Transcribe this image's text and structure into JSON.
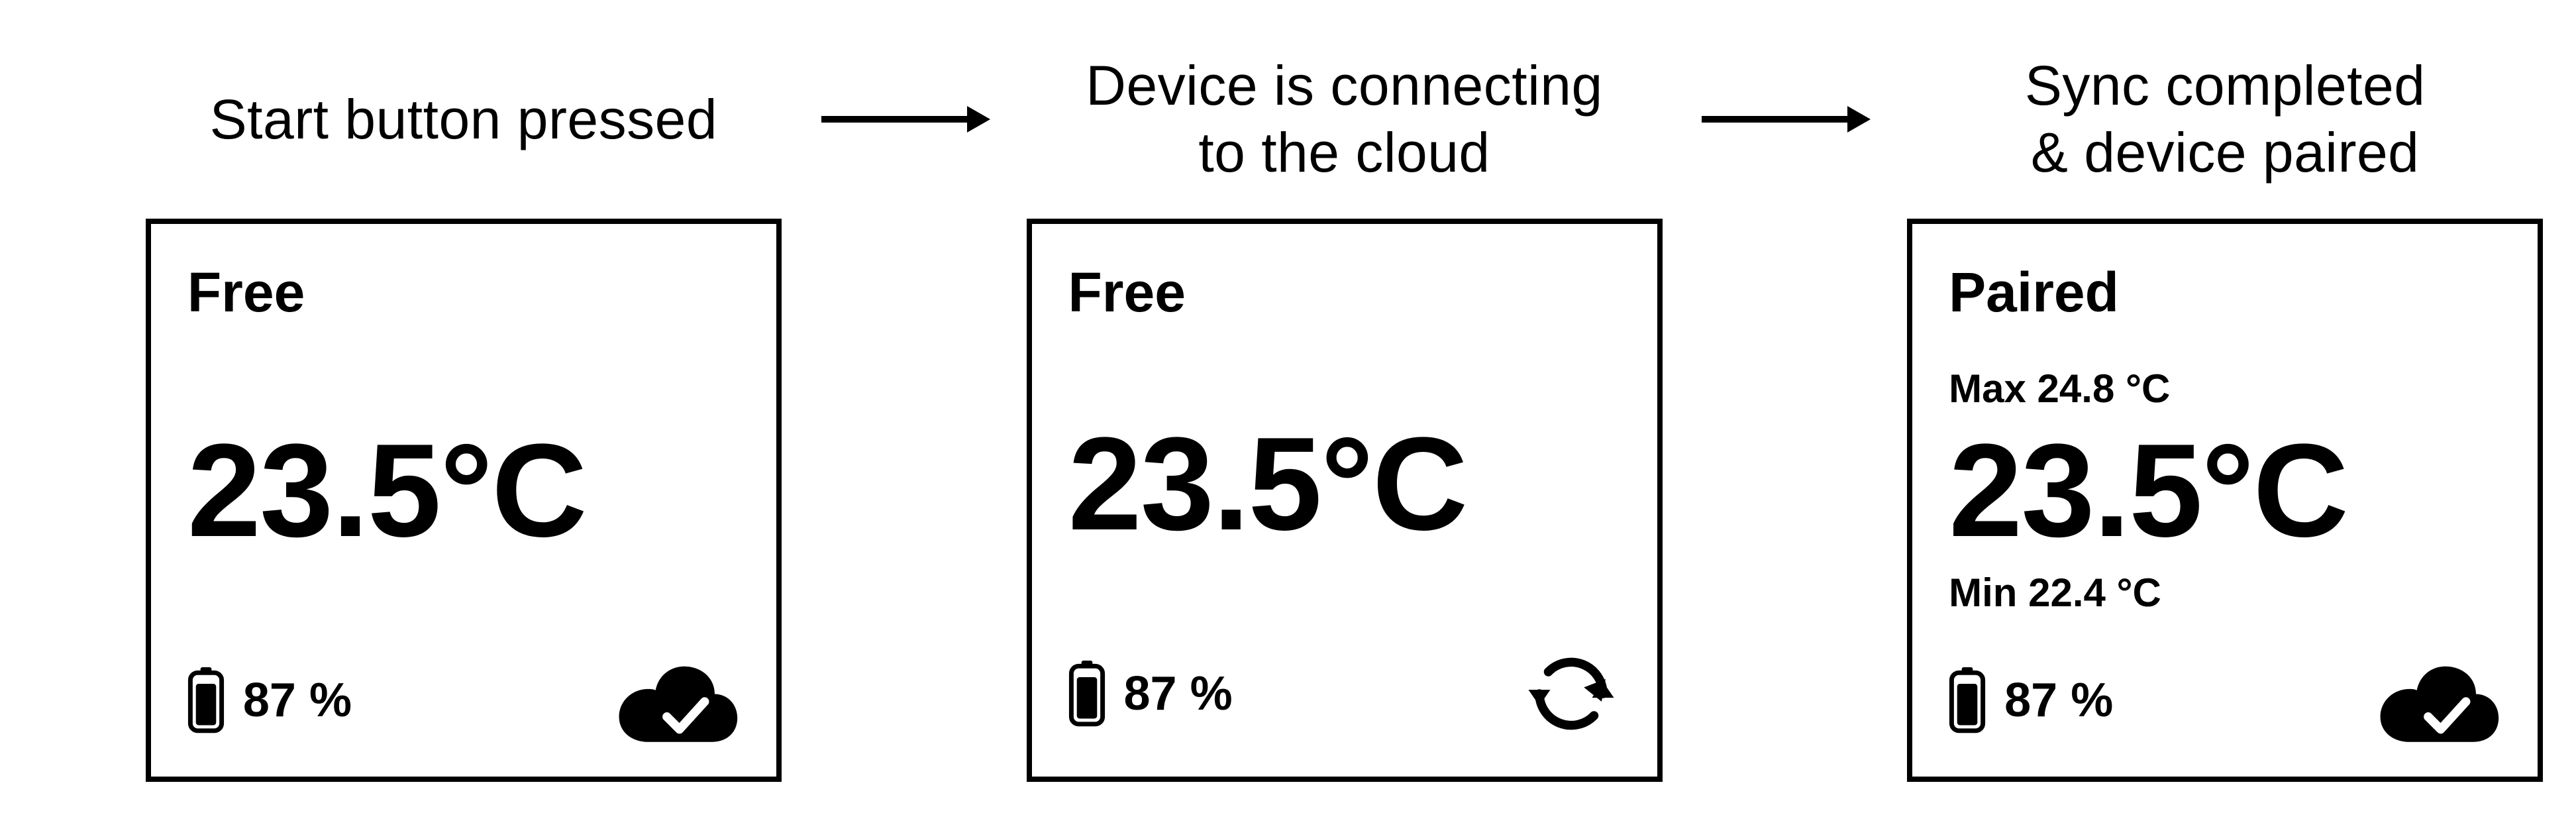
{
  "captions": {
    "step1": "Start button pressed",
    "step2": "Device is connecting\nto the cloud",
    "step3": "Sync completed\n& device paired"
  },
  "screens": [
    {
      "status": "Free",
      "temperature": "23.5°C",
      "battery": "87 %",
      "footer_icon": "cloud-check"
    },
    {
      "status": "Free",
      "temperature": "23.5°C",
      "battery": "87 %",
      "footer_icon": "sync"
    },
    {
      "status": "Paired",
      "max": "Max 24.8 °C",
      "temperature": "23.5°C",
      "min": "Min 22.4 °C",
      "battery": "87 %",
      "footer_icon": "cloud-check"
    }
  ]
}
